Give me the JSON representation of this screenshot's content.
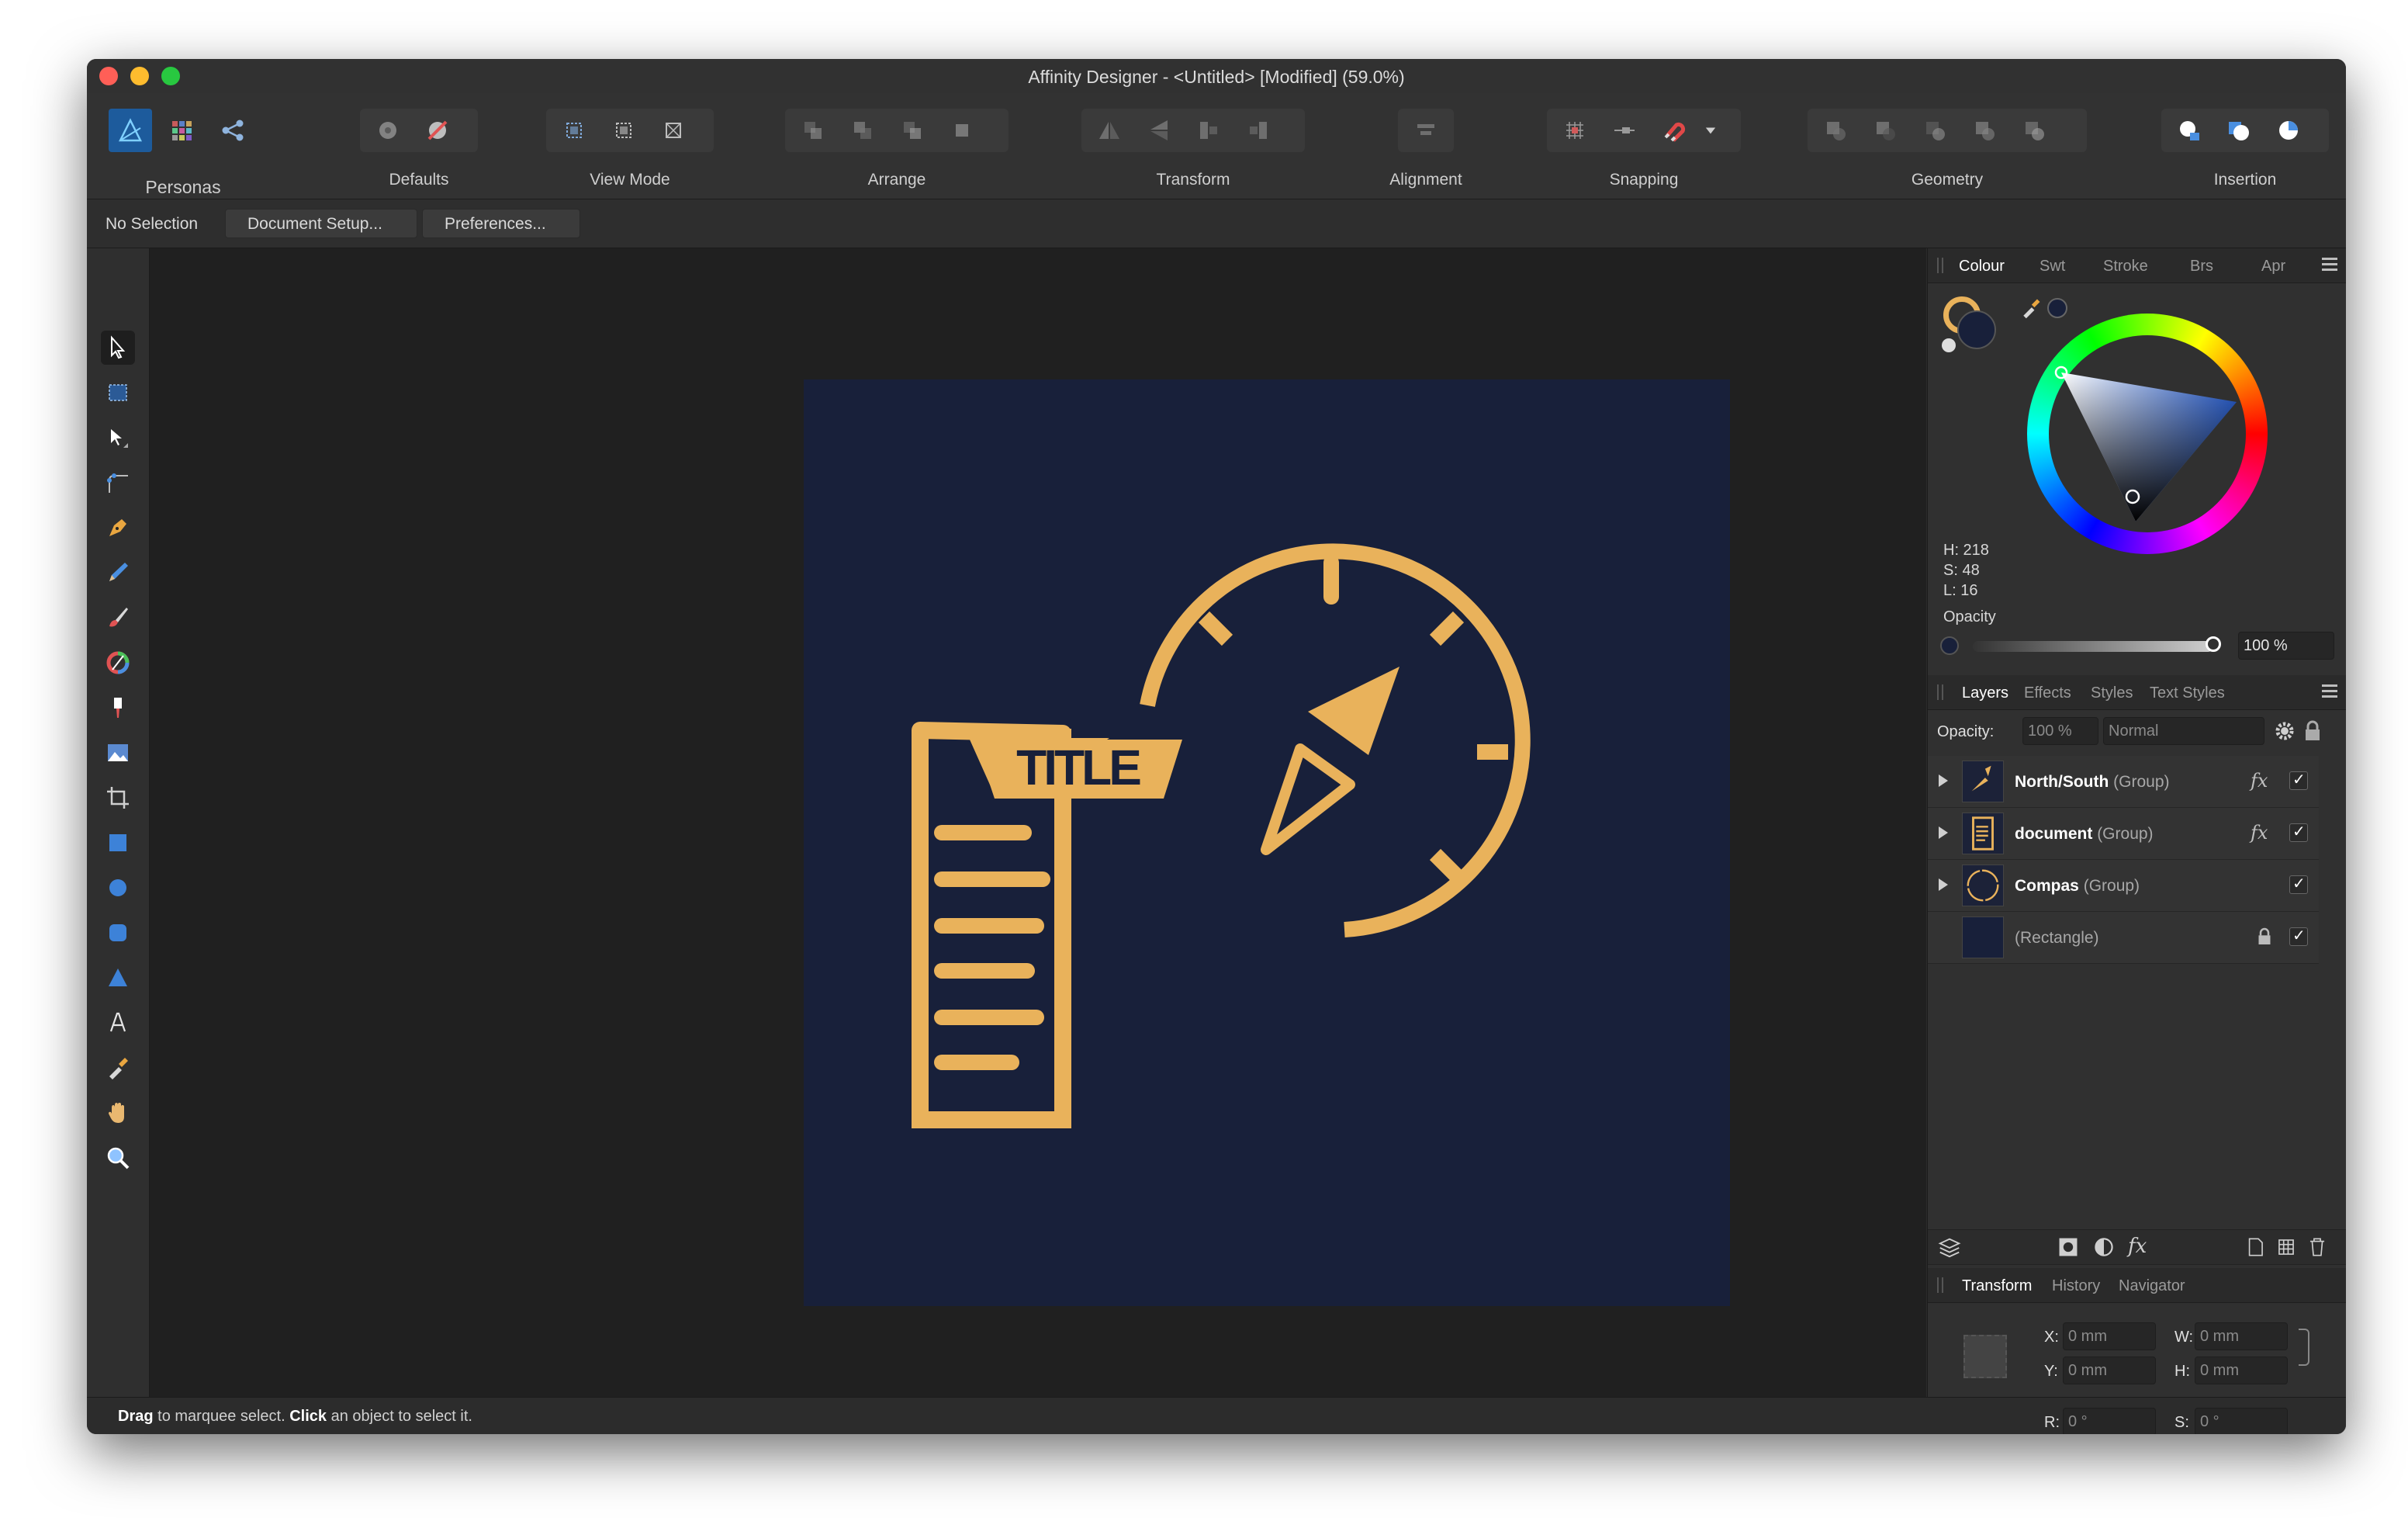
{
  "window": {
    "title": "Affinity Designer - <Untitled> [Modified] (59.0%)"
  },
  "toolbar": {
    "personas": "Personas",
    "defaults": "Defaults",
    "view_mode": "View Mode",
    "arrange": "Arrange",
    "transform": "Transform",
    "alignment": "Alignment",
    "snapping": "Snapping",
    "geometry": "Geometry",
    "insertion": "Insertion"
  },
  "context": {
    "selection": "No Selection",
    "document_setup": "Document Setup...",
    "preferences": "Preferences..."
  },
  "artwork": {
    "title_text": "TITLE",
    "fill": "#e9b25b",
    "background": "#18203a"
  },
  "colour_panel": {
    "tabs": [
      "Colour",
      "Swt",
      "Stroke",
      "Brs",
      "Apr"
    ],
    "h": "H: 218",
    "s": "S: 48",
    "l": "L: 16",
    "opacity_label": "Opacity",
    "opacity_value": "100 %"
  },
  "layers_panel": {
    "tabs": [
      "Layers",
      "Effects",
      "Styles",
      "Text Styles"
    ],
    "opacity_label": "Opacity:",
    "opacity_value": "100 %",
    "blend_mode": "Normal",
    "layers": [
      {
        "name": "North/South",
        "type": "(Group)"
      },
      {
        "name": "document",
        "type": "(Group)"
      },
      {
        "name": "Compas",
        "type": "(Group)"
      },
      {
        "name": "",
        "type": "(Rectangle)"
      }
    ]
  },
  "transform_panel": {
    "tabs": [
      "Transform",
      "History",
      "Navigator"
    ],
    "x_label": "X:",
    "x_value": "0 mm",
    "y_label": "Y:",
    "y_value": "0 mm",
    "w_label": "W:",
    "w_value": "0 mm",
    "h_label": "H:",
    "h_value": "0 mm",
    "r_label": "R:",
    "r_value": "0 °",
    "s_label": "S:",
    "s_value": "0 °"
  },
  "status": {
    "drag": "Drag",
    "drag_text": "to marquee select.",
    "click": "Click",
    "click_text": "an object to select it."
  }
}
